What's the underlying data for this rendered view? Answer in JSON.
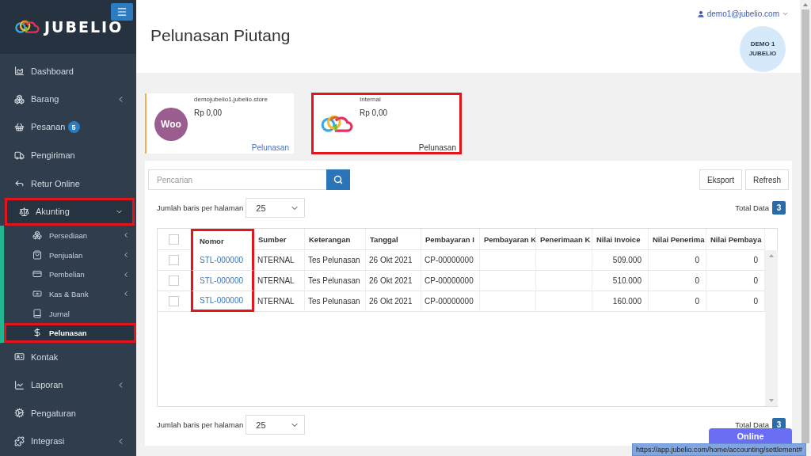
{
  "brand": {
    "name": "JUBELIO"
  },
  "sidebar": {
    "items": [
      {
        "label": "Dashboard",
        "expandable": false,
        "expanded": false,
        "highlighted": false
      },
      {
        "label": "Barang",
        "expandable": true,
        "expanded": false,
        "highlighted": false
      },
      {
        "label": "Pesanan",
        "badge": "5",
        "expandable": false,
        "expanded": false,
        "highlighted": false
      },
      {
        "label": "Pengiriman",
        "expandable": false,
        "expanded": false,
        "highlighted": false
      },
      {
        "label": "Retur Online",
        "expandable": false,
        "expanded": false,
        "highlighted": false
      },
      {
        "label": "Akunting",
        "expandable": true,
        "expanded": true,
        "highlighted": true,
        "children": [
          {
            "label": "Persediaan",
            "expandable": true,
            "highlighted": false,
            "selected": false
          },
          {
            "label": "Penjualan",
            "expandable": true,
            "highlighted": false,
            "selected": false
          },
          {
            "label": "Pembelian",
            "expandable": true,
            "highlighted": false,
            "selected": false
          },
          {
            "label": "Kas & Bank",
            "expandable": true,
            "highlighted": false,
            "selected": false
          },
          {
            "label": "Jurnal",
            "expandable": false,
            "highlighted": false,
            "selected": false
          },
          {
            "label": "Pelunasan",
            "expandable": false,
            "highlighted": true,
            "selected": true
          }
        ]
      },
      {
        "label": "Kontak",
        "expandable": false,
        "expanded": false,
        "highlighted": false
      },
      {
        "label": "Laporan",
        "expandable": true,
        "expanded": false,
        "highlighted": false
      },
      {
        "label": "Pengaturan",
        "expandable": false,
        "expanded": false,
        "highlighted": false
      },
      {
        "label": "Integrasi",
        "expandable": true,
        "expanded": false,
        "highlighted": false
      }
    ]
  },
  "header": {
    "title": "Pelunasan Piutang",
    "user": "demo1@jubelio.com",
    "avatar": "DEMO 1 JUBELIO"
  },
  "cards": [
    {
      "kind": "woo",
      "logo_text": "Woo",
      "title": "demojubelio1.jubelio.store",
      "amount": "Rp 0,00",
      "link": "Pelunasan",
      "accent": true,
      "highlighted": false
    },
    {
      "kind": "jubelio",
      "title": "Internal",
      "amount": "Rp 0,00",
      "link": "Pelunasan",
      "accent": false,
      "highlighted": true
    }
  ],
  "toolbar": {
    "search_placeholder": "Pencarian",
    "buttons": [
      "Eksport",
      "Refresh"
    ]
  },
  "paging_top": {
    "label": "Jumlah baris per halaman",
    "value": "25",
    "total_label": "Total Data",
    "total": "3"
  },
  "table": {
    "columns": [
      {
        "label": "Nomor",
        "kind": "link",
        "highlighted": true
      },
      {
        "label": "Sumber",
        "kind": "text",
        "highlighted": false
      },
      {
        "label": "Keterangan",
        "kind": "text",
        "highlighted": false
      },
      {
        "label": "Tanggal",
        "kind": "text",
        "highlighted": false
      },
      {
        "label": "Pembayaran I",
        "kind": "text",
        "highlighted": false
      },
      {
        "label": "Pembayaran K",
        "kind": "text",
        "highlighted": false
      },
      {
        "label": "Penerimaan K",
        "kind": "text",
        "highlighted": false
      },
      {
        "label": "Nilai Invoice",
        "kind": "number",
        "highlighted": false
      },
      {
        "label": "Nilai Penerima",
        "kind": "number",
        "highlighted": false
      },
      {
        "label": "Nilai Pembaya",
        "kind": "number",
        "highlighted": false
      }
    ],
    "header_checked": false,
    "rows": [
      {
        "checked": false,
        "cells": [
          "STL-000000",
          "NTERNAL",
          "Tes Pelunasan",
          "26 Okt 2021",
          "CP-00000000",
          "",
          "",
          "509.000",
          "0",
          "0"
        ]
      },
      {
        "checked": false,
        "cells": [
          "STL-000000",
          "NTERNAL",
          "Tes Pelunasan",
          "26 Okt 2021",
          "CP-00000000",
          "",
          "",
          "510.000",
          "0",
          "0"
        ]
      },
      {
        "checked": false,
        "cells": [
          "STL-000000",
          "NTERNAL",
          "Tes Pelunasan",
          "26 Okt 2021",
          "CP-00000000",
          "",
          "",
          "160.000",
          "0",
          "0"
        ]
      }
    ]
  },
  "paging_bottom": {
    "label": "Jumlah baris per halaman",
    "value": "25",
    "total_label": "Total Data",
    "total": "3"
  },
  "online_button": "Online",
  "status_url": "https://app.jubelio.com/home/accounting/settlement#"
}
